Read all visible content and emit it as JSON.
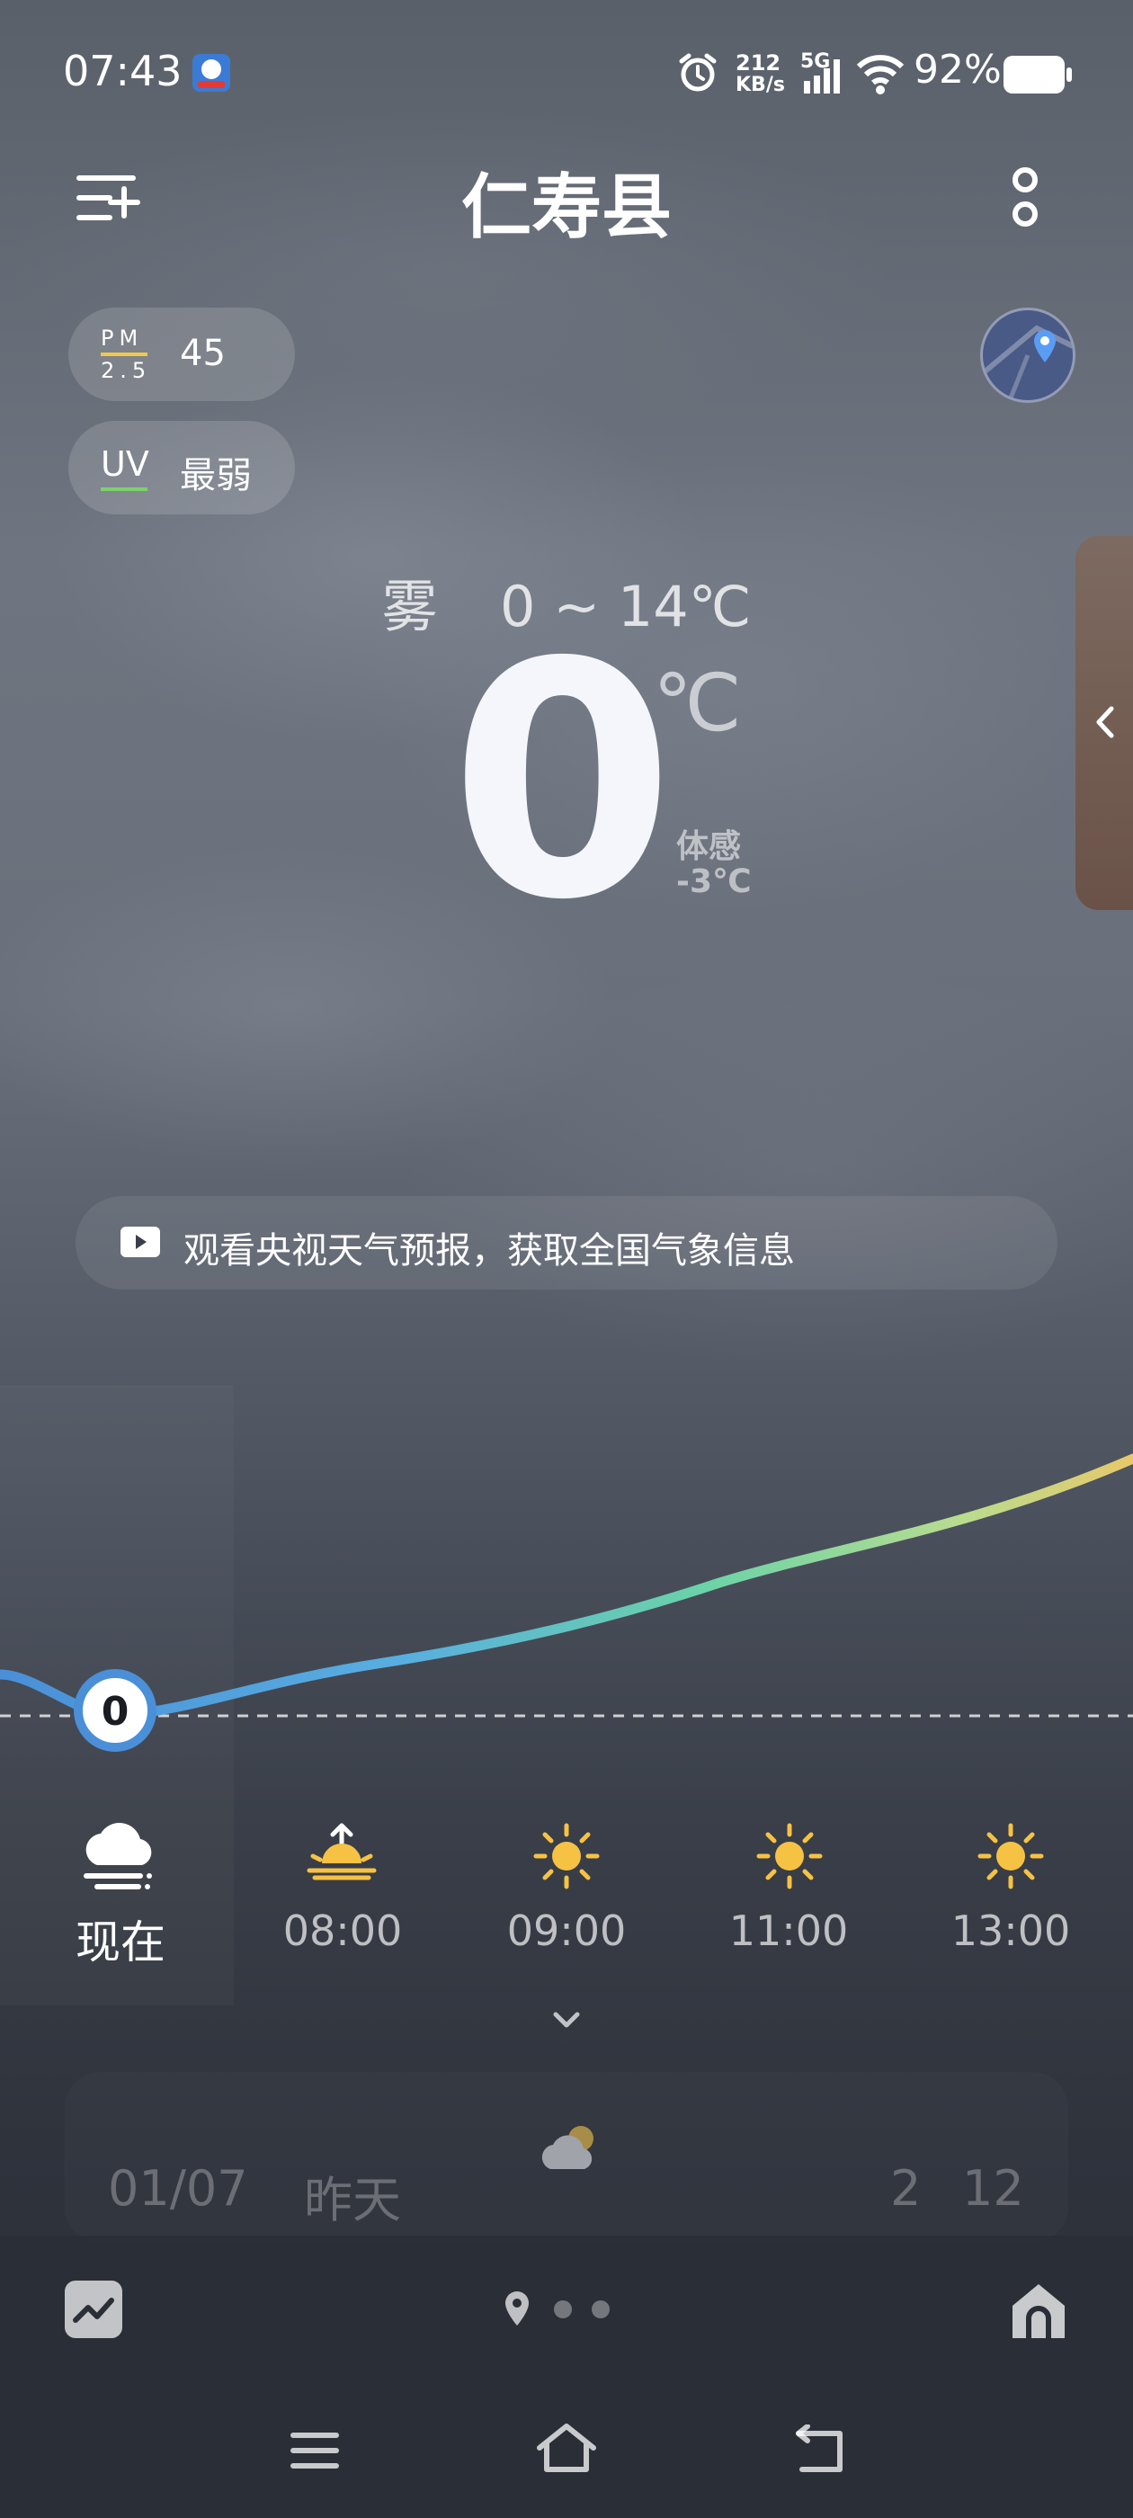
{
  "status_bar": {
    "time": "07:43",
    "net_speed_value": "212",
    "net_speed_unit": "KB/s",
    "network": "5G",
    "battery": "92%"
  },
  "header": {
    "city": "仁寿县"
  },
  "air": {
    "pm_label_top": "PM",
    "pm_label_bottom": "2.5",
    "pm_value": "45",
    "uv_label": "UV",
    "uv_value": "最弱"
  },
  "current": {
    "condition": "雾",
    "range": "0 ~ 14℃",
    "temp": "0",
    "unit": "℃",
    "feels_label": "体感",
    "feels_value": "-3℃"
  },
  "banner": {
    "text": "观看央视天气预报，获取全国气象信息"
  },
  "hourly": {
    "now_value": "0",
    "items": [
      {
        "label": "现在",
        "icon": "fog-cloud-icon"
      },
      {
        "label": "08:00",
        "icon": "sunrise-icon"
      },
      {
        "label": "09:00",
        "icon": "sun-icon"
      },
      {
        "label": "11:00",
        "icon": "sun-icon"
      },
      {
        "label": "13:00",
        "icon": "sun-icon"
      }
    ]
  },
  "daily": {
    "date": "01/07",
    "day": "昨天",
    "icon": "partly-cloudy-icon",
    "low": "2",
    "high": "12"
  },
  "colors": {
    "curve_start": "#4a8fd8",
    "curve_mid": "#6ad3a8",
    "curve_end": "#e8c86a",
    "sun": "#f6c244"
  }
}
